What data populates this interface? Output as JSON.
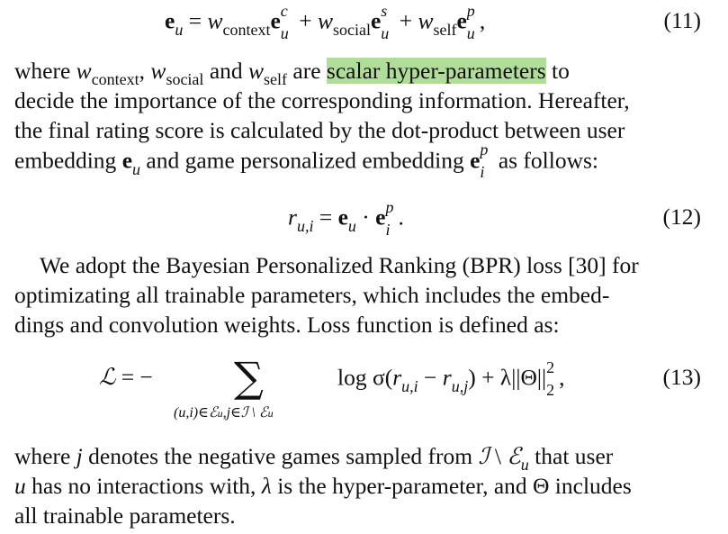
{
  "eq11": {
    "e": "e",
    "u": "u",
    "eqsign": "=",
    "plus1": "+",
    "plus2": "+",
    "w": "w",
    "ctx": "context",
    "soc": "social",
    "self": "self",
    "c": "c",
    "s": "s",
    "p": "p",
    "comma": ",",
    "num": "(11)"
  },
  "para1": {
    "l1_a": "where ",
    "l1_w1": "w",
    "l1_ctx": "context",
    "l1_c1": ", ",
    "l1_w2": "w",
    "l1_soc": "social",
    "l1_and": " and ",
    "l1_w3": "w",
    "l1_self": "self",
    "l1_are": " are ",
    "l1_hl": "scalar hyper-parameters",
    "l1_to": " to",
    "l2": "decide the importance of the corresponding information. Hereafter,",
    "l3": "the final rating score is calculated by the dot-product between user",
    "l4_a": "embedding ",
    "l4_e": "e",
    "l4_u": "u",
    "l4_b": " and game personalized embedding ",
    "l4_e2": "e",
    "l4_p": "p",
    "l4_i": "i",
    "l4_c": " as follows:"
  },
  "eq12": {
    "r": "r",
    "ui": "u,i",
    "eqsign": " = ",
    "e": "e",
    "u": "u",
    "dot": " · ",
    "e2": "e",
    "p": "p",
    "i": "i",
    "period": ".",
    "num": "(12)"
  },
  "para2": {
    "l1": "We adopt the Bayesian Personalized Ranking (BPR) loss [30] for",
    "l2": "optimizating all trainable parameters, which includes the embed-",
    "l3": "dings and convolution weights. Loss function is defined as:"
  },
  "eq13": {
    "L": "ℒ",
    "eqneg": " = −",
    "sum": "∑",
    "sumsub": "(u,i)∈ℰ",
    "sumsub_u1": "u",
    "sumsub_mid": ",j∈ℐ \\ ℰ",
    "sumsub_u2": "u",
    "log": "log σ(",
    "r1": "r",
    "ui": "u,i",
    "minus": " − ",
    "r2": "r",
    "uj": "u,j",
    "close": ") + λ||Θ||",
    "two_sup": "2",
    "two_sub": "2",
    "comma": ",",
    "num": "(13)"
  },
  "para3": {
    "l1_a": "where ",
    "l1_j": "j",
    "l1_b": " denotes the negative games sampled from ",
    "l1_I": "ℐ",
    "l1_set": " \\ ",
    "l1_E": "ℰ",
    "l1_u": "u",
    "l1_c": " that user",
    "l2_u": "u",
    "l2_a": " has no interactions with, ",
    "l2_l": "λ",
    "l2_b": " is the hyper-parameter, and Θ includes",
    "l3": "all trainable parameters."
  }
}
